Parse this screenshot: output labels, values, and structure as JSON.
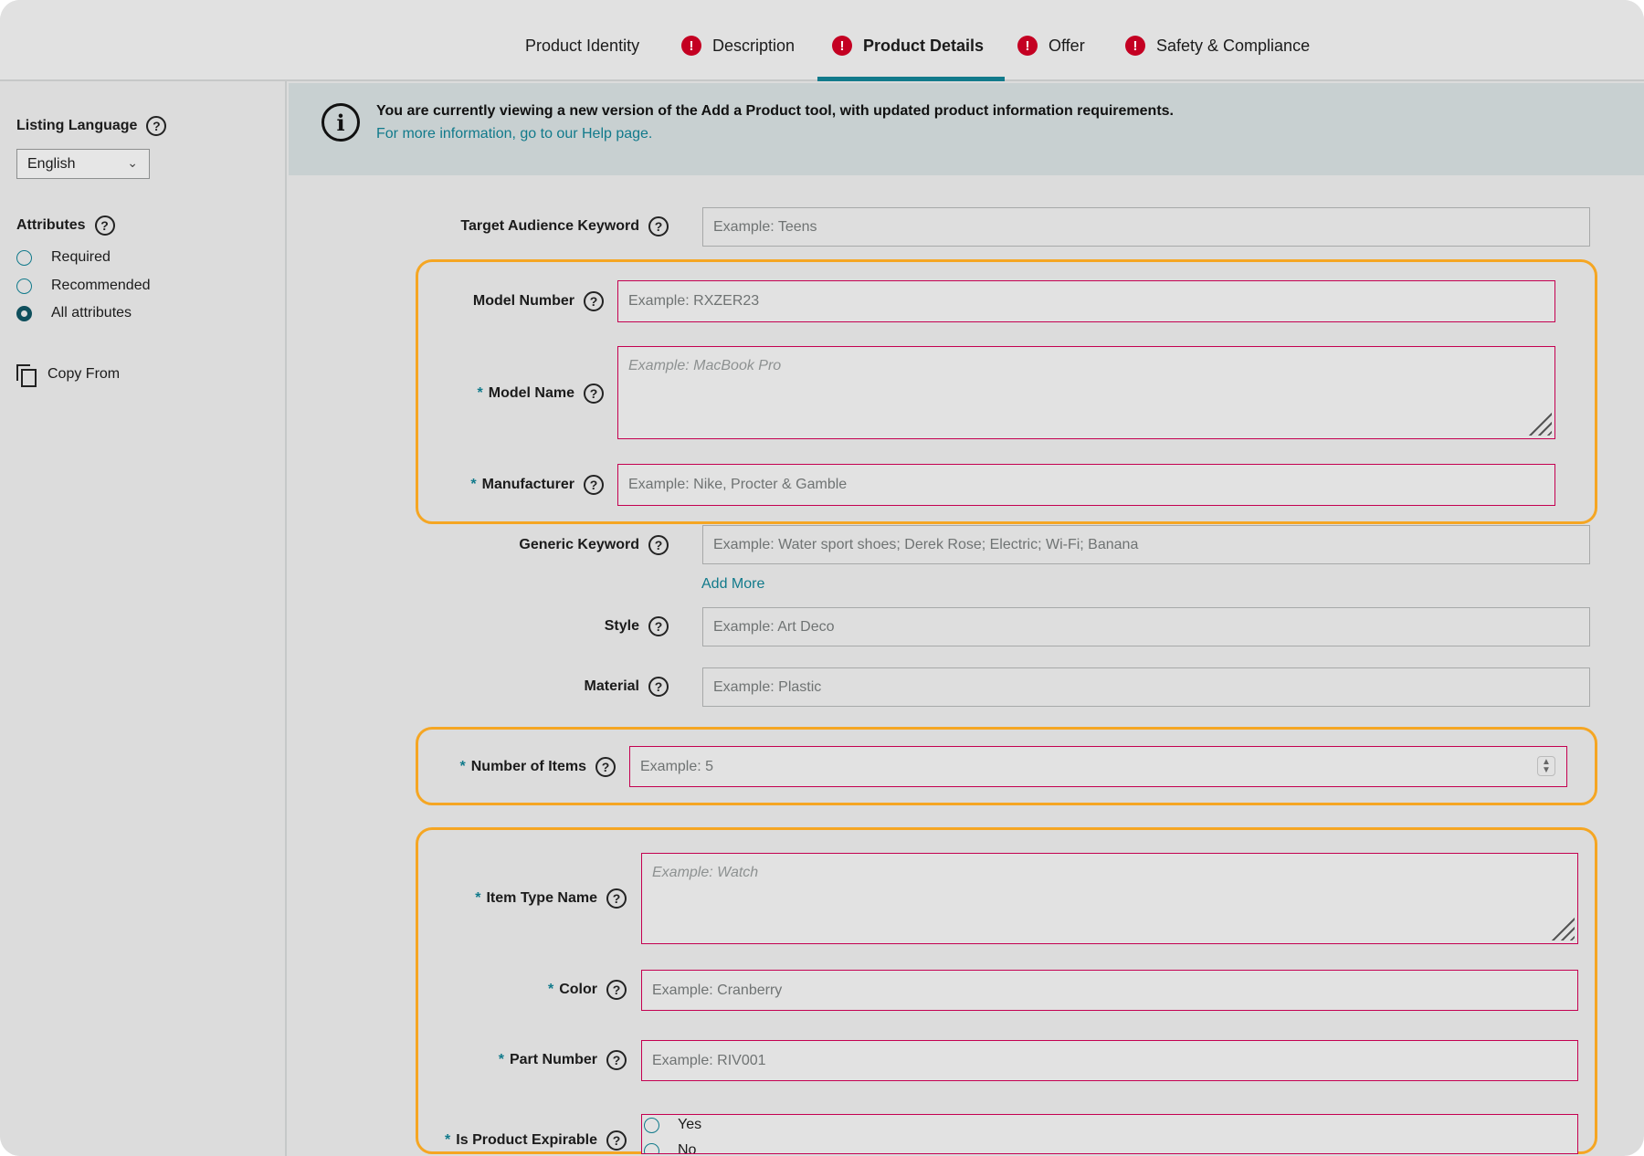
{
  "tabs": [
    {
      "label": "Product Identity",
      "error": false,
      "active": false
    },
    {
      "label": "Description",
      "error": true,
      "active": false
    },
    {
      "label": "Product Details",
      "error": true,
      "active": true
    },
    {
      "label": "Offer",
      "error": true,
      "active": false
    },
    {
      "label": "Safety & Compliance",
      "error": true,
      "active": false
    }
  ],
  "sidebar": {
    "listing_language_label": "Listing Language",
    "language_value": "English",
    "attributes_label": "Attributes",
    "attribute_options": [
      "Required",
      "Recommended",
      "All attributes"
    ],
    "selected_attribute": "All attributes",
    "copy_from_label": "Copy From"
  },
  "banner": {
    "title": "You are currently viewing a new version of the Add a Product tool, with updated product information requirements.",
    "link": "For more information, go to our Help page."
  },
  "form": {
    "target_audience": {
      "label": "Target Audience Keyword",
      "placeholder": "Example: Teens"
    },
    "model_number": {
      "label": "Model Number",
      "placeholder": "Example: RXZER23"
    },
    "model_name": {
      "label": "Model Name",
      "placeholder": "Example: MacBook Pro"
    },
    "manufacturer": {
      "label": "Manufacturer",
      "placeholder": "Example: Nike, Procter & Gamble"
    },
    "generic_keyword": {
      "label": "Generic Keyword",
      "placeholder": "Example: Water sport shoes; Derek Rose; Electric; Wi-Fi; Banana"
    },
    "add_more": "Add More",
    "style": {
      "label": "Style",
      "placeholder": "Example: Art Deco"
    },
    "material": {
      "label": "Material",
      "placeholder": "Example: Plastic"
    },
    "number_of_items": {
      "label": "Number of Items",
      "placeholder": "Example: 5"
    },
    "item_type_name": {
      "label": "Item Type Name",
      "placeholder": "Example: Watch"
    },
    "color": {
      "label": "Color",
      "placeholder": "Example: Cranberry"
    },
    "part_number": {
      "label": "Part Number",
      "placeholder": "Example: RIV001"
    },
    "is_product_expirable": {
      "label": "Is Product Expirable",
      "options": [
        "Yes",
        "No"
      ]
    },
    "required_marker": "*"
  },
  "colors": {
    "accent": "#117a8b",
    "error": "#c40022",
    "highlight": "#f5a623",
    "required_border": "#c40050"
  }
}
